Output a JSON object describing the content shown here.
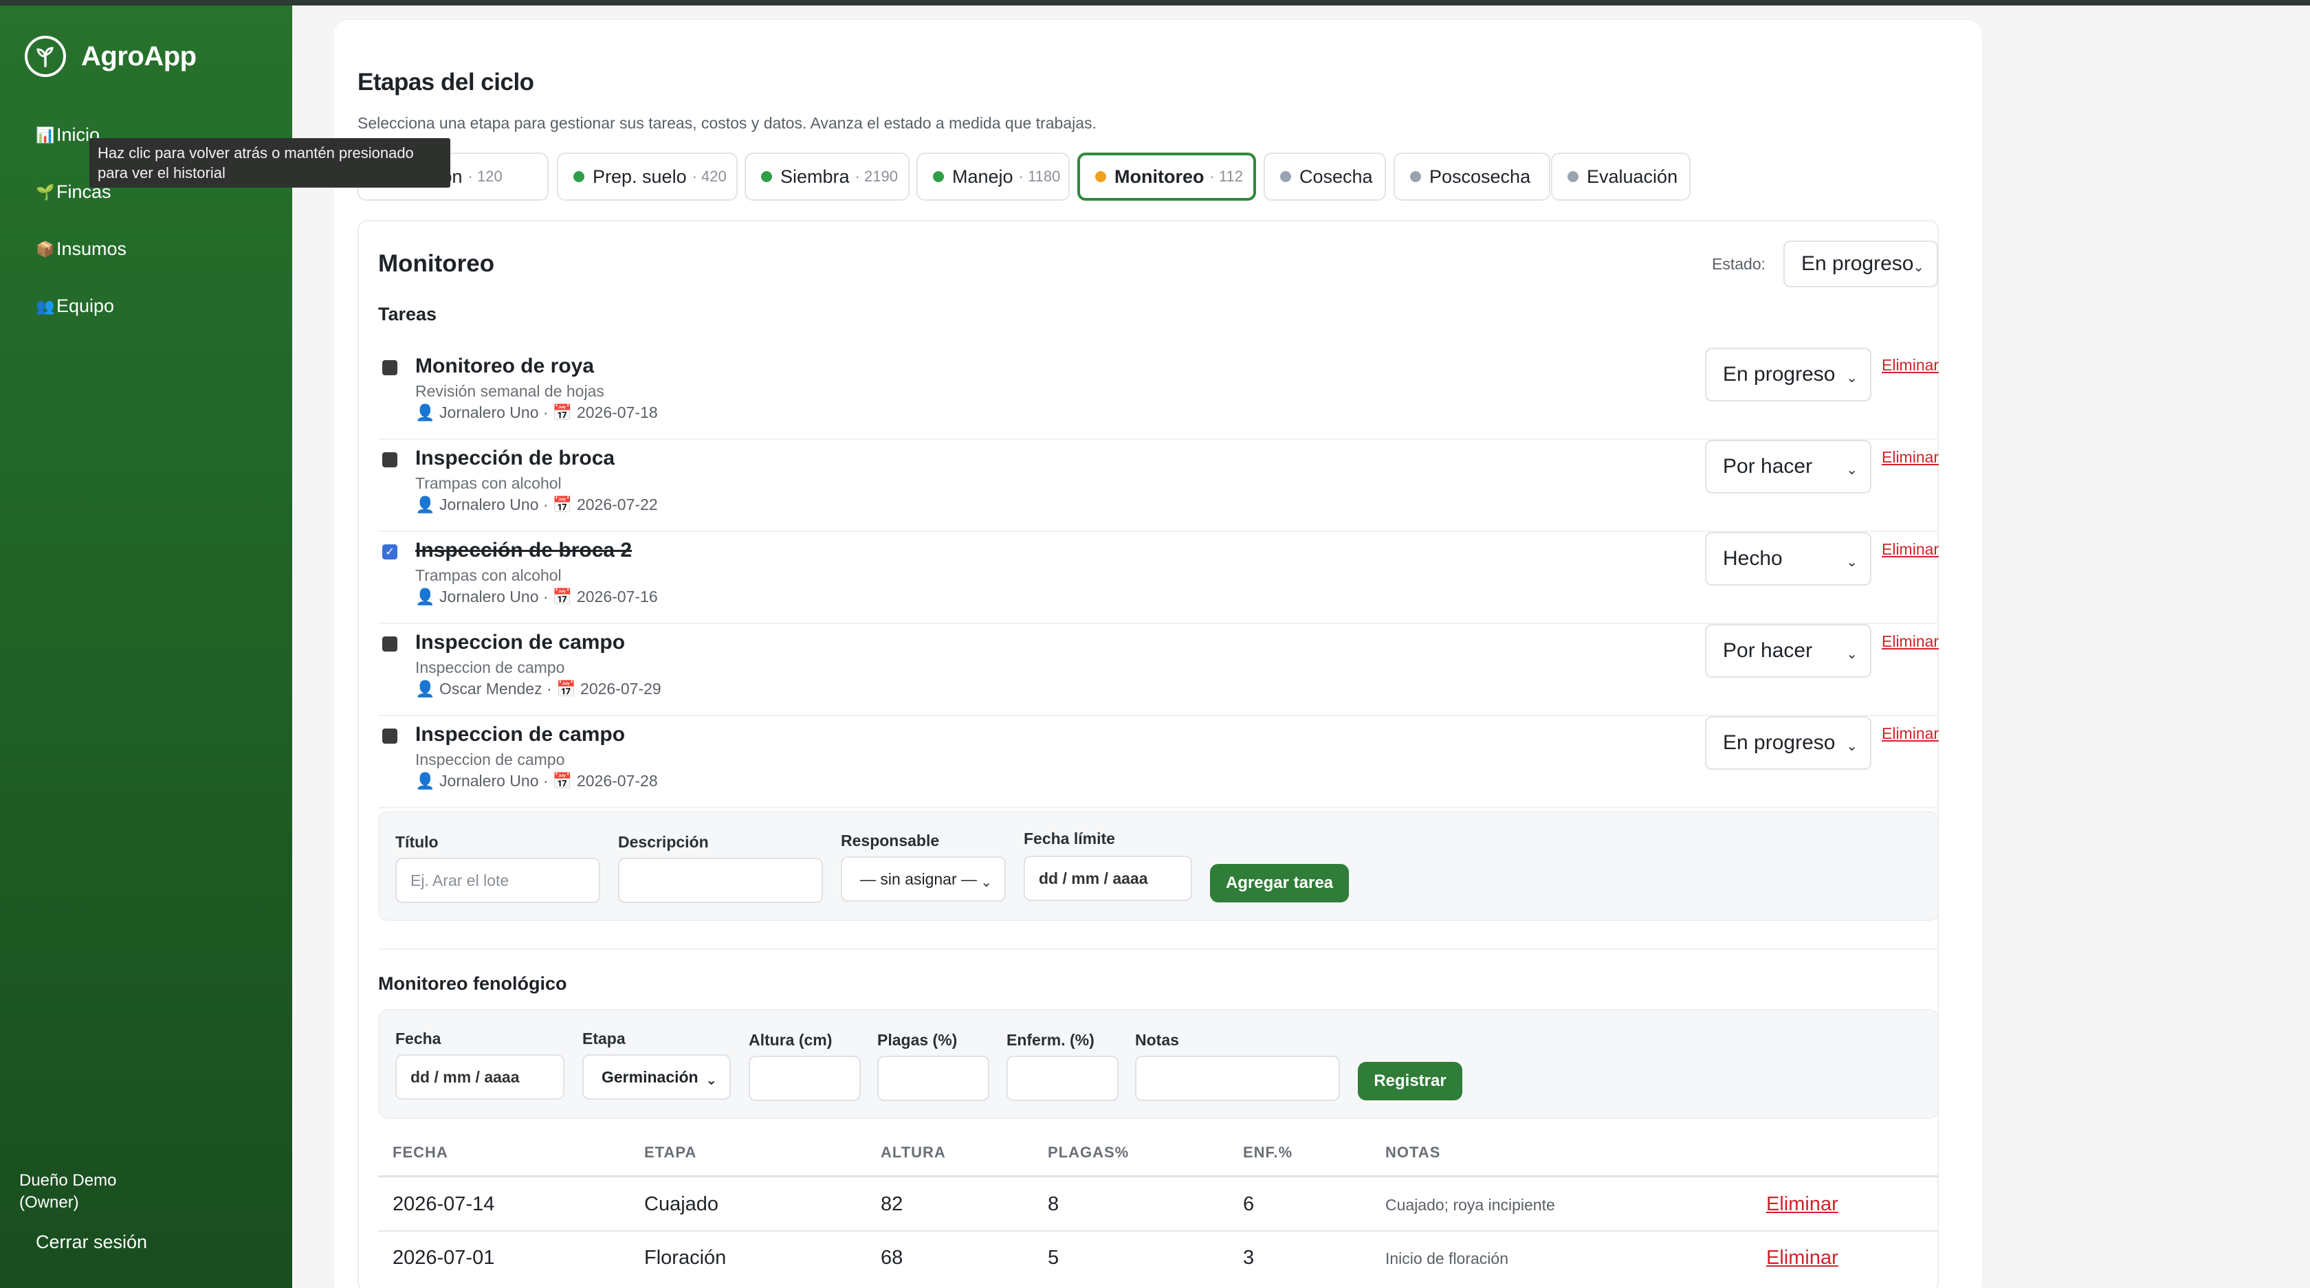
{
  "app": {
    "name": "AgroApp"
  },
  "sidebar": {
    "items": [
      {
        "icon": "📊",
        "label": "Inicio"
      },
      {
        "icon": "🌱",
        "label": "Fincas"
      },
      {
        "icon": "📦",
        "label": "Insumos"
      },
      {
        "icon": "👥",
        "label": "Equipo"
      }
    ],
    "tooltip": "Haz clic para volver atrás o mantén presionado para ver el historial",
    "user": "Dueño Demo (Owner)",
    "logout": "Cerrar sesión"
  },
  "header": {
    "title": "Etapas del ciclo",
    "subtitle": "Selecciona una etapa para gestionar sus tareas, costos y datos. Avanza el estado a medida que trabajas."
  },
  "stages": [
    {
      "label": "Planeación",
      "visible_label": "ación",
      "count": "· 120",
      "color": "#2e9e47"
    },
    {
      "label": "Prep. suelo",
      "count": "· 420",
      "color": "#2e9e47"
    },
    {
      "label": "Siembra",
      "count": "· 2190",
      "color": "#2e9e47"
    },
    {
      "label": "Manejo",
      "count": "· 1180",
      "color": "#2e9e47"
    },
    {
      "label": "Monitoreo",
      "count": "· 112",
      "color": "#f0a020",
      "active": true
    },
    {
      "label": "Cosecha",
      "count": "",
      "color": "#9aa3b0"
    },
    {
      "label": "Poscosecha",
      "count": "",
      "color": "#9aa3b0"
    },
    {
      "label": "Evaluación",
      "count": "",
      "color": "#9aa3b0"
    }
  ],
  "panel": {
    "title": "Monitoreo",
    "estado_label": "Estado:",
    "estado_value": "En progreso",
    "tasks_label": "Tareas",
    "delete_label": "Eliminar"
  },
  "tasks": [
    {
      "title": "Monitoreo de roya",
      "desc": "Revisión semanal de hojas",
      "meta": "👤 Jornalero Uno · 📅 2026-07-18",
      "status": "En progreso",
      "done": false
    },
    {
      "title": "Inspección de broca",
      "desc": "Trampas con alcohol",
      "meta": "👤 Jornalero Uno · 📅 2026-07-22",
      "status": "Por hacer",
      "done": false
    },
    {
      "title": "Inspección de broca 2",
      "desc": "Trampas con alcohol",
      "meta": "👤 Jornalero Uno · 📅 2026-07-16",
      "status": "Hecho",
      "done": true
    },
    {
      "title": "Inspeccion de campo",
      "desc": "Inspeccion de campo",
      "meta": "👤 Oscar Mendez · 📅 2026-07-29",
      "status": "Por hacer",
      "done": false
    },
    {
      "title": "Inspeccion de campo",
      "desc": "Inspeccion de campo",
      "meta": "👤 Jornalero Uno · 📅 2026-07-28",
      "status": "En progreso",
      "done": false
    }
  ],
  "task_form": {
    "title_label": "Título",
    "title_placeholder": "Ej. Arar el lote",
    "desc_label": "Descripción",
    "resp_label": "Responsable",
    "resp_value": "— sin asignar —",
    "date_label": "Fecha límite",
    "date_value": "dd / mm / aaaa",
    "submit": "Agregar tarea"
  },
  "pheno": {
    "title": "Monitoreo fenológico",
    "form": {
      "fecha_label": "Fecha",
      "fecha_value": "dd / mm / aaaa",
      "etapa_label": "Etapa",
      "etapa_value": "Germinación",
      "altura_label": "Altura (cm)",
      "plagas_label": "Plagas (%)",
      "enferm_label": "Enferm. (%)",
      "notas_label": "Notas",
      "submit": "Registrar"
    },
    "columns": [
      "FECHA",
      "ETAPA",
      "ALTURA",
      "PLAGAS%",
      "ENF.%",
      "NOTAS"
    ],
    "rows": [
      {
        "fecha": "2026-07-14",
        "etapa": "Cuajado",
        "altura": "82",
        "plagas": "8",
        "enf": "6",
        "notas": "Cuajado; roya incipiente",
        "action": "Eliminar"
      },
      {
        "fecha": "2026-07-01",
        "etapa": "Floración",
        "altura": "68",
        "plagas": "5",
        "enf": "3",
        "notas": "Inicio de floración",
        "action": "Eliminar"
      }
    ]
  }
}
